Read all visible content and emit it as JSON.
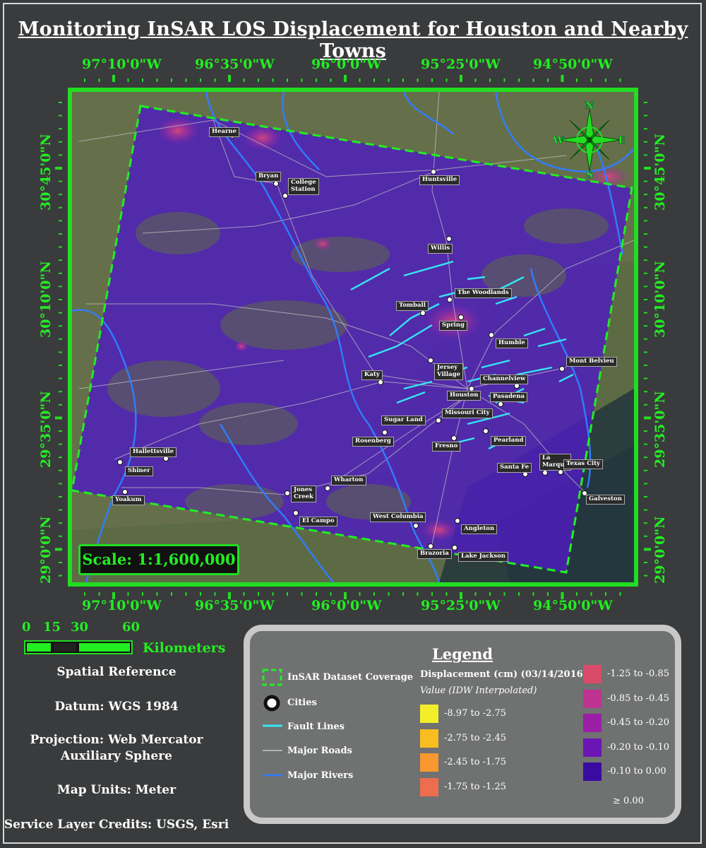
{
  "title": "Monitoring InSAR LOS Displacement for Houston and Nearby Towns",
  "graticule": {
    "lon_labels": [
      "97°10'0\"W",
      "96°35'0\"W",
      "96°0'0\"W",
      "95°25'0\"W",
      "94°50'0\"W"
    ],
    "lat_labels": [
      "30°45'0\"N",
      "30°10'0\"N",
      "29°35'0\"N",
      "29°0'0\"N"
    ]
  },
  "cities": [
    {
      "name": "Hearne",
      "dot": [
        227,
        62
      ],
      "label": [
        194,
        50
      ]
    },
    {
      "name": "Bryan",
      "dot": [
        289,
        130
      ],
      "label": [
        260,
        113
      ]
    },
    {
      "name": "College\nStation",
      "dot": [
        302,
        147
      ],
      "label": [
        306,
        122
      ]
    },
    {
      "name": "Huntsville",
      "dot": [
        512,
        113
      ],
      "label": [
        492,
        118
      ]
    },
    {
      "name": "Willis",
      "dot": [
        534,
        208
      ],
      "label": [
        504,
        215
      ]
    },
    {
      "name": "The Woodlands",
      "dot": [
        535,
        294
      ],
      "label": [
        542,
        278
      ]
    },
    {
      "name": "Tomball",
      "dot": [
        497,
        313
      ],
      "label": [
        459,
        296
      ]
    },
    {
      "name": "Spring",
      "dot": [
        551,
        319
      ],
      "label": [
        520,
        324
      ]
    },
    {
      "name": "Humble",
      "dot": [
        594,
        344
      ],
      "label": [
        600,
        349
      ]
    },
    {
      "name": "Mont Belvieu",
      "dot": [
        694,
        392
      ],
      "label": [
        700,
        375
      ]
    },
    {
      "name": "Katy",
      "dot": [
        437,
        411
      ],
      "label": [
        410,
        394
      ]
    },
    {
      "name": "Jersey\nVillage",
      "dot": [
        508,
        380
      ],
      "label": [
        513,
        384
      ]
    },
    {
      "name": "Channelview",
      "dot": [
        630,
        416
      ],
      "label": [
        578,
        400
      ]
    },
    {
      "name": "Houston",
      "dot": [
        566,
        420
      ],
      "label": [
        531,
        423
      ]
    },
    {
      "name": "Pasadena",
      "dot": [
        607,
        442
      ],
      "label": [
        592,
        425
      ]
    },
    {
      "name": "Sugar Land",
      "dot": [
        491,
        464
      ],
      "label": [
        438,
        458
      ]
    },
    {
      "name": "Missouri City",
      "dot": [
        519,
        465
      ],
      "label": [
        524,
        448
      ]
    },
    {
      "name": "Rosenberg",
      "dot": [
        443,
        482
      ],
      "label": [
        397,
        488
      ]
    },
    {
      "name": "Fresno",
      "dot": [
        541,
        490
      ],
      "label": [
        510,
        495
      ]
    },
    {
      "name": "Pearland",
      "dot": [
        586,
        480
      ],
      "label": [
        593,
        487
      ]
    },
    {
      "name": "Hallettsville",
      "dot": [
        133,
        519
      ],
      "label": [
        82,
        503
      ]
    },
    {
      "name": "Shiner",
      "dot": [
        68,
        524
      ],
      "label": [
        75,
        530
      ]
    },
    {
      "name": "Santa Fe",
      "dot": [
        642,
        541
      ],
      "label": [
        602,
        525
      ]
    },
    {
      "name": "La\nMarque",
      "dot": [
        670,
        539
      ],
      "label": [
        662,
        512
      ]
    },
    {
      "name": "Texas City",
      "dot": [
        692,
        538
      ],
      "label": [
        696,
        520
      ]
    },
    {
      "name": "Wharton",
      "dot": [
        362,
        561
      ],
      "label": [
        367,
        543
      ]
    },
    {
      "name": "Jones\nCreek",
      "dot": [
        305,
        568
      ],
      "label": [
        310,
        557
      ]
    },
    {
      "name": "Yoakum",
      "dot": [
        75,
        566
      ],
      "label": [
        57,
        571
      ]
    },
    {
      "name": "El Campo",
      "dot": [
        317,
        596
      ],
      "label": [
        322,
        601
      ]
    },
    {
      "name": "Galveston",
      "dot": [
        726,
        568
      ],
      "label": [
        728,
        570
      ]
    },
    {
      "name": "West Columbia",
      "dot": [
        487,
        614
      ],
      "label": [
        422,
        595
      ]
    },
    {
      "name": "Angleton",
      "dot": [
        546,
        607
      ],
      "label": [
        551,
        612
      ]
    },
    {
      "name": "Brazoria",
      "dot": [
        508,
        643
      ],
      "label": [
        489,
        647
      ]
    },
    {
      "name": "Lake Jackson",
      "dot": [
        542,
        645
      ],
      "label": [
        547,
        651
      ]
    }
  ],
  "compass": {
    "n": "N",
    "s": "S",
    "e": "E",
    "w": "W"
  },
  "scale": {
    "text": "Scale: 1:1,600,000"
  },
  "scalebar": {
    "ticks": [
      "0",
      "15",
      "30",
      "60"
    ],
    "units": "Kilometers"
  },
  "reference": {
    "heading": "Spatial Reference",
    "datum": "Datum: WGS 1984",
    "projection_1": "Projection: Web Mercator",
    "projection_2": "Auxiliary Sphere",
    "units": "Map Units: Meter",
    "credits": "Service Layer Credits: USGS, Esri"
  },
  "legend": {
    "title": "Legend",
    "items": {
      "coverage": "InSAR Dataset Coverage",
      "cities": "Cities",
      "faults": "Fault Lines",
      "roads": "Major Roads",
      "rivers": "Major Rivers"
    },
    "displacement_heading": "Displacement (cm) (03/14/2016)",
    "displacement_sub": "Value (IDW Interpolated)",
    "classes": [
      {
        "label": "-8.97 to -2.75",
        "color": "#f2ee2a"
      },
      {
        "label": "-2.75 to -2.45",
        "color": "#f9bd20"
      },
      {
        "label": "-2.45 to -1.75",
        "color": "#f8982e"
      },
      {
        "label": "-1.75 to -1.25",
        "color": "#ed6d4f"
      },
      {
        "label": "-1.25 to -0.85",
        "color": "#d94b68"
      },
      {
        "label": "-0.85 to -0.45",
        "color": "#be3392"
      },
      {
        "label": "-0.45 to -0.20",
        "color": "#9a1ea6"
      },
      {
        "label": "-0.20 to -0.10",
        "color": "#6b15b5"
      },
      {
        "label": "-0.10 to 0.00",
        "color": "#3a0ba0"
      }
    ],
    "extra": "≥ 0.00"
  },
  "colors": {
    "accent_green": "#22dd22",
    "fault": "#35e6f2",
    "road": "#c8c8c8",
    "river": "#2f7dff"
  }
}
